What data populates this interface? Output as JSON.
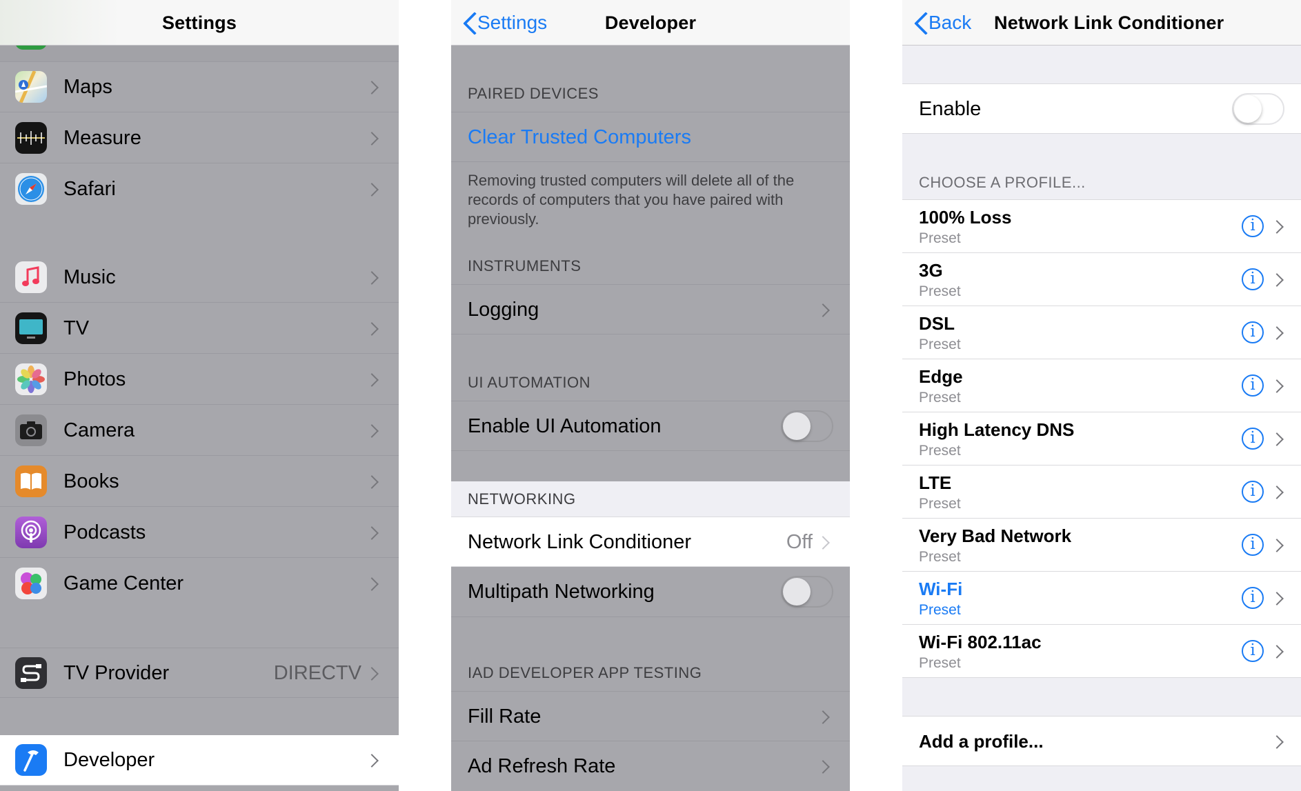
{
  "settings": {
    "title": "Settings",
    "items": [
      {
        "label": "Maps",
        "icon": "maps-icon"
      },
      {
        "label": "Measure",
        "icon": "measure-icon"
      },
      {
        "label": "Safari",
        "icon": "safari-icon"
      },
      {
        "label": "Music",
        "icon": "music-icon"
      },
      {
        "label": "TV",
        "icon": "tv-icon"
      },
      {
        "label": "Photos",
        "icon": "photos-icon"
      },
      {
        "label": "Camera",
        "icon": "camera-icon"
      },
      {
        "label": "Books",
        "icon": "books-icon"
      },
      {
        "label": "Podcasts",
        "icon": "podcasts-icon"
      },
      {
        "label": "Game Center",
        "icon": "game-center-icon"
      }
    ],
    "tv_provider": {
      "label": "TV Provider",
      "value": "DIRECTV",
      "icon": "tv-provider-icon"
    },
    "developer": {
      "label": "Developer",
      "icon": "developer-icon"
    }
  },
  "developer": {
    "back_label": "Settings",
    "title": "Developer",
    "paired_header": "PAIRED DEVICES",
    "clear_trusted": "Clear Trusted Computers",
    "clear_note": "Removing trusted computers will delete all of the records of computers that you have paired with previously.",
    "instruments_header": "INSTRUMENTS",
    "logging": "Logging",
    "ui_automation_header": "UI AUTOMATION",
    "enable_ui_automation": "Enable UI Automation",
    "networking_header": "NETWORKING",
    "network_link_conditioner": "Network Link Conditioner",
    "network_link_value": "Off",
    "multipath": "Multipath Networking",
    "iad_header": "IAD DEVELOPER APP TESTING",
    "fill_rate": "Fill Rate",
    "ad_refresh_rate": "Ad Refresh Rate"
  },
  "nlc": {
    "back_label": "Back",
    "title": "Network Link Conditioner",
    "enable_label": "Enable",
    "profile_header": "CHOOSE A PROFILE...",
    "profiles": [
      {
        "name": "100% Loss",
        "sub": "Preset"
      },
      {
        "name": "3G",
        "sub": "Preset"
      },
      {
        "name": "DSL",
        "sub": "Preset"
      },
      {
        "name": "Edge",
        "sub": "Preset"
      },
      {
        "name": "High Latency DNS",
        "sub": "Preset"
      },
      {
        "name": "LTE",
        "sub": "Preset"
      },
      {
        "name": "Very Bad Network",
        "sub": "Preset"
      },
      {
        "name": "Wi-Fi",
        "sub": "Preset"
      },
      {
        "name": "Wi-Fi 802.11ac",
        "sub": "Preset"
      }
    ],
    "add_profile": "Add a profile...",
    "accent_color": "#1a7bf4"
  }
}
